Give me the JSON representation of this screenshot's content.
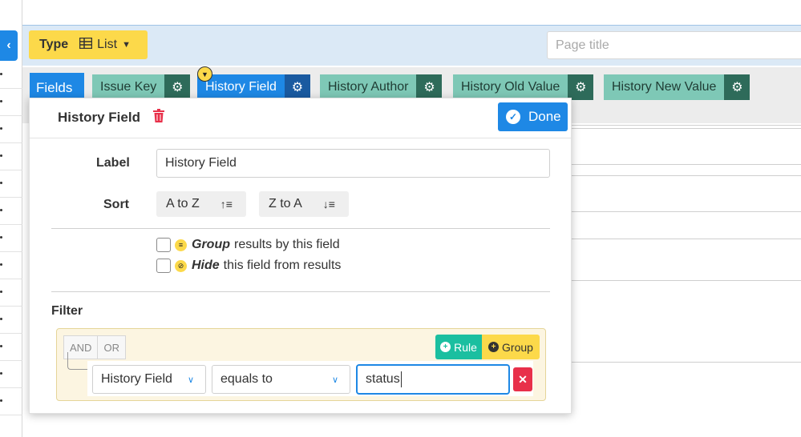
{
  "toolbar": {
    "back_icon": "chevron-left-icon",
    "type_label": "Type",
    "type_value": "List",
    "type_icon": "table-icon",
    "page_title_placeholder": "Page title"
  },
  "fields": {
    "label": "Fields",
    "chips": [
      {
        "name": "Issue Key",
        "active": false
      },
      {
        "name": "History Field",
        "active": true
      },
      {
        "name": "History Author",
        "active": false
      },
      {
        "name": "History Old Value",
        "active": false
      },
      {
        "name": "History New Value",
        "active": false
      }
    ]
  },
  "editor": {
    "title": "History Field",
    "done_label": "Done",
    "label_caption": "Label",
    "label_value": "History Field",
    "sort_caption": "Sort",
    "sort_asc": "A to Z",
    "sort_desc": "Z to A",
    "group_option_bold": "Group",
    "group_option_rest": "results by this field",
    "hide_option_bold": "Hide",
    "hide_option_rest": "this field from results",
    "filter_caption": "Filter"
  },
  "filter": {
    "and_label": "AND",
    "or_label": "OR",
    "rule_button": "Rule",
    "group_button": "Group",
    "field_select": "History Field",
    "operator_select": "equals to",
    "value": "status",
    "delete_icon": "close-icon"
  },
  "colors": {
    "primary": "#1e88e5",
    "field_chip": "#7ec8b6",
    "field_gear": "#2e6b5a",
    "yellow": "#fcd94a",
    "teal": "#1bbfa0",
    "danger": "#e8304a"
  }
}
